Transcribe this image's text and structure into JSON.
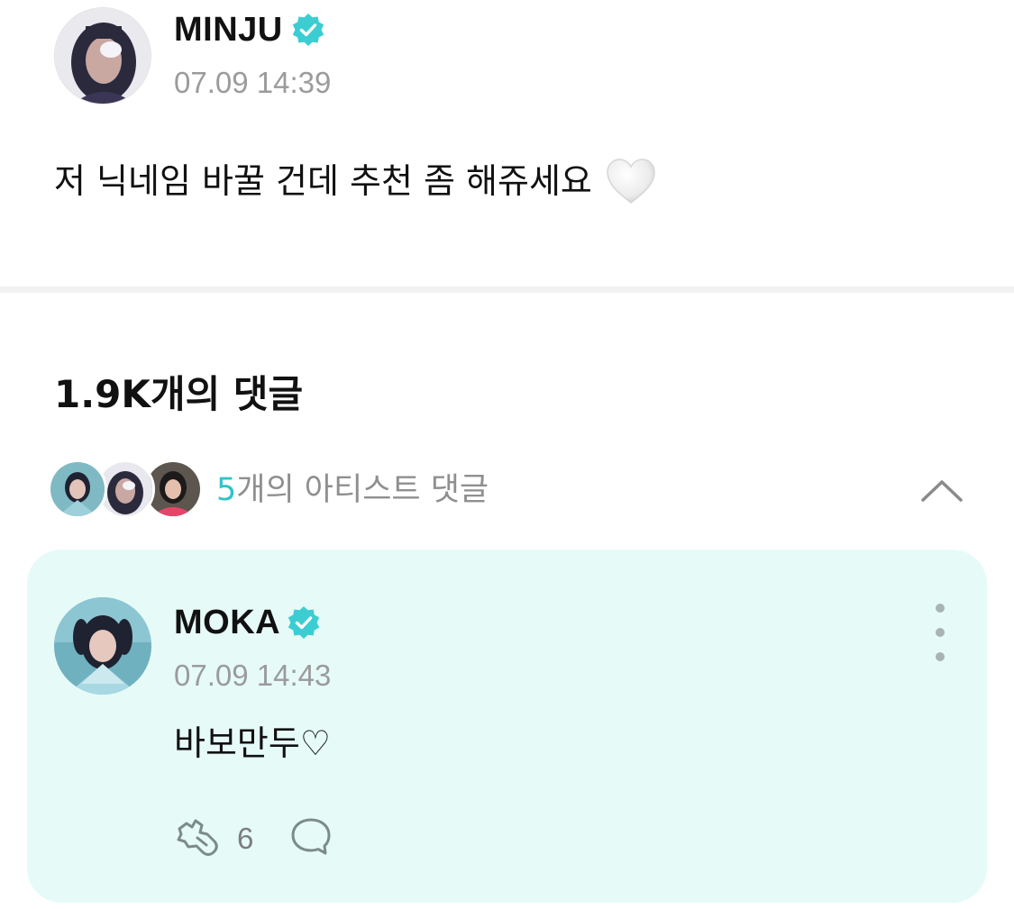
{
  "post": {
    "author": "MINJU",
    "verified": true,
    "timestamp": "07.09 14:39",
    "text": "저 닉네임 바꿀 건데 추천 좀 해쥬세요",
    "emoji": "white-heart-icon"
  },
  "comments": {
    "count_label": "1.9K개의 댓글",
    "artist_section": {
      "count": "5",
      "label": "개의 아티스트 댓글",
      "expanded": true
    },
    "artist_comment": {
      "author": "MOKA",
      "verified": true,
      "timestamp": "07.09 14:43",
      "text": "바보만두♡",
      "like_count": "6",
      "background": "#e6fbf8"
    }
  },
  "colors": {
    "accent": "#2fc4c8",
    "verified_badge": "#3ccdd3",
    "muted_text": "#9b9b9b",
    "card_bg": "#e6fbf8"
  }
}
